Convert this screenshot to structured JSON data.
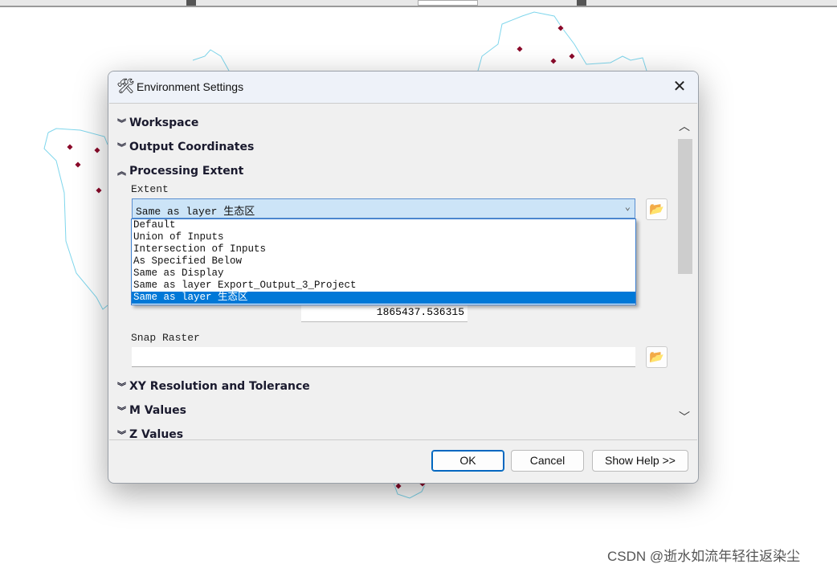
{
  "dialog": {
    "title": "Environment Settings",
    "title_icon": "tools-icon",
    "close_icon": "close-icon"
  },
  "sections": {
    "workspace": "Workspace",
    "output_coordinates": "Output Coordinates",
    "processing_extent": "Processing Extent",
    "xy_resolution": "XY Resolution and Tolerance",
    "m_values": "M Values",
    "z_values": "Z Values"
  },
  "extent": {
    "label": "Extent",
    "selected": "Same as layer 生态区",
    "options": [
      "Default",
      "Union of Inputs",
      "Intersection of Inputs",
      "As Specified Below",
      "Same as Display",
      "Same as layer Export_Output_3_Project",
      "Same as layer 生态区"
    ],
    "value_field": "1865437.536315"
  },
  "snap_raster": {
    "label": "Snap Raster",
    "value": ""
  },
  "buttons": {
    "ok": "OK",
    "cancel": "Cancel",
    "help": "Show Help >>"
  },
  "watermark": "CSDN @逝水如流年轻往返染尘",
  "colors": {
    "map_outline": "#7fd6ec",
    "map_point": "#8b0a2a",
    "selection": "#0078d7"
  }
}
